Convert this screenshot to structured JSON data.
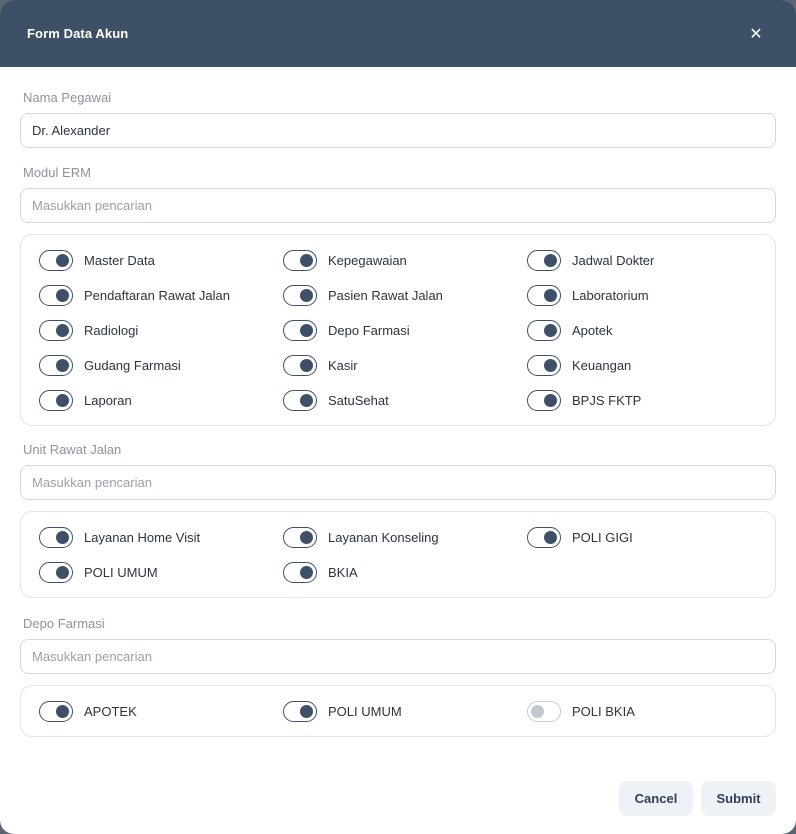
{
  "modal": {
    "title": "Form Data Akun",
    "close_symbol": "✕"
  },
  "employee": {
    "label": "Nama Pegawai",
    "value": "Dr. Alexander"
  },
  "erm": {
    "label": "Modul ERM",
    "search_placeholder": "Masukkan pencarian",
    "modules": [
      {
        "label": "Master Data",
        "on": true
      },
      {
        "label": "Kepegawaian",
        "on": true
      },
      {
        "label": "Jadwal Dokter",
        "on": true
      },
      {
        "label": "Pendaftaran Rawat Jalan",
        "on": true
      },
      {
        "label": "Pasien Rawat Jalan",
        "on": true
      },
      {
        "label": "Laboratorium",
        "on": true
      },
      {
        "label": "Radiologi",
        "on": true
      },
      {
        "label": "Depo Farmasi",
        "on": true
      },
      {
        "label": "Apotek",
        "on": true
      },
      {
        "label": "Gudang Farmasi",
        "on": true
      },
      {
        "label": "Kasir",
        "on": true
      },
      {
        "label": "Keuangan",
        "on": true
      },
      {
        "label": "Laporan",
        "on": true
      },
      {
        "label": "SatuSehat",
        "on": true
      },
      {
        "label": "BPJS FKTP",
        "on": true
      }
    ]
  },
  "outpatient": {
    "label": "Unit Rawat Jalan",
    "search_placeholder": "Masukkan pencarian",
    "units": [
      {
        "label": "Layanan Home Visit",
        "on": true
      },
      {
        "label": "Layanan Konseling",
        "on": true
      },
      {
        "label": "POLI GIGI",
        "on": true
      },
      {
        "label": "POLI UMUM",
        "on": true
      },
      {
        "label": "BKIA",
        "on": true
      }
    ]
  },
  "pharmacy": {
    "label": "Depo Farmasi",
    "search_placeholder": "Masukkan pencarian",
    "depots": [
      {
        "label": "APOTEK",
        "on": true
      },
      {
        "label": "POLI UMUM",
        "on": true
      },
      {
        "label": "POLI BKIA",
        "on": false
      }
    ]
  },
  "footer": {
    "cancel_label": "Cancel",
    "submit_label": "Submit"
  },
  "colors": {
    "header": "#3e5068",
    "toggle_on": "#3e5068",
    "toggle_off": "#c2c7ce"
  }
}
